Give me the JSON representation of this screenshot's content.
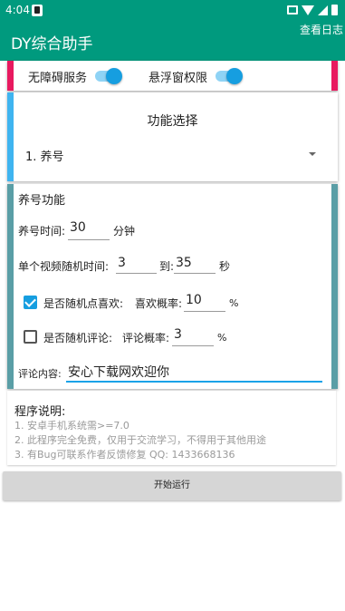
{
  "status_bar": {
    "time": "4:04"
  },
  "app_bar": {
    "title": "DY综合助手",
    "action": "查看日志"
  },
  "permissions": {
    "accessibility_label": "无障碍服务",
    "accessibility_on": true,
    "overlay_label": "悬浮窗权限",
    "overlay_on": true
  },
  "function_select": {
    "heading": "功能选择",
    "selected": "1. 养号"
  },
  "yanghao": {
    "title": "养号功能",
    "time_label": "养号时间:",
    "time_value": "30",
    "time_unit": "分钟",
    "video_label": "单个视频随机时间:",
    "video_min": "3",
    "to_label": "到:",
    "video_max": "35",
    "video_unit": "秒",
    "like_label": "是否随机点喜欢:",
    "like_checked": true,
    "like_prob_label": "喜欢概率:",
    "like_prob": "10",
    "like_prob_unit": "%",
    "comment_label": "是否随机评论:",
    "comment_checked": false,
    "comment_prob_label": "评论概率:",
    "comment_prob": "3",
    "comment_prob_unit": "%",
    "comment_content_label": "评论内容:",
    "comment_content": "安心下载网欢迎你"
  },
  "notes": {
    "title": "程序说明:",
    "lines": [
      "1. 安卓手机系统需>=7.0",
      "2. 此程序完全免费，仅用于交流学习，不得用于其他用途",
      "3. 有Bug可联系作者反馈修复 QQ: 1433668136"
    ]
  },
  "start_button": "开始运行",
  "colors": {
    "primary": "#009a7e",
    "accent_pink": "#e8195f",
    "accent_blue": "#3fb4f0",
    "accent_teal": "#5a9ea6",
    "switch_on": "#169ee0"
  }
}
